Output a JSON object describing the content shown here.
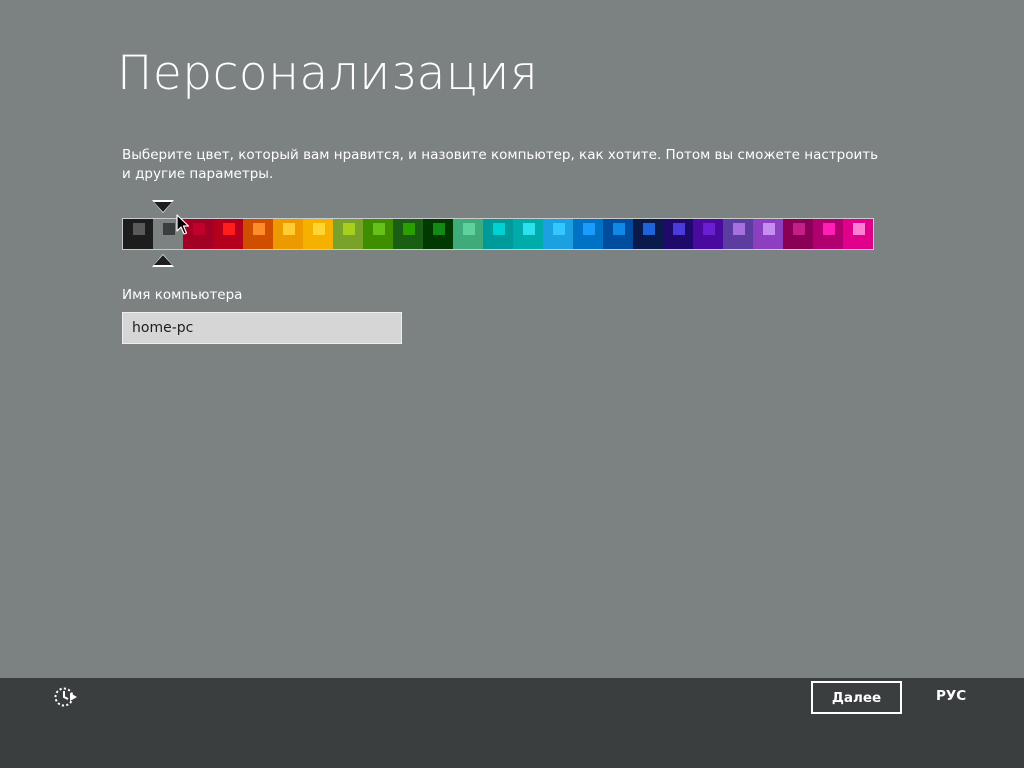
{
  "page": {
    "title": "Персонализация",
    "description": "Выберите цвет, который вам нравится, и назовите компьютер, как хотите. Потом вы сможете настроить и другие параметры."
  },
  "palette": {
    "selected_index": 1,
    "swatches": [
      {
        "background": "#1d1d1d",
        "accent": "#5a5a5a"
      },
      {
        "background": "#7c8282",
        "accent": "#3b3e3e"
      },
      {
        "background": "#a20025",
        "accent": "#c1002d"
      },
      {
        "background": "#b4001c",
        "accent": "#ff1d1d"
      },
      {
        "background": "#d04e00",
        "accent": "#ff8c2a"
      },
      {
        "background": "#ec9a00",
        "accent": "#ffcc33"
      },
      {
        "background": "#f6b100",
        "accent": "#ffd633"
      },
      {
        "background": "#78a22a",
        "accent": "#a6d01a"
      },
      {
        "background": "#3e8e00",
        "accent": "#66c21a"
      },
      {
        "background": "#195e13",
        "accent": "#2b9e00"
      },
      {
        "background": "#003a00",
        "accent": "#138a13"
      },
      {
        "background": "#3faa7a",
        "accent": "#5ed19d"
      },
      {
        "background": "#009a9a",
        "accent": "#00d2d2"
      },
      {
        "background": "#00abab",
        "accent": "#2be1ee"
      },
      {
        "background": "#1ba1e2",
        "accent": "#34c6ff"
      },
      {
        "background": "#0072c6",
        "accent": "#1a9cff"
      },
      {
        "background": "#004c9e",
        "accent": "#0d8ae8"
      },
      {
        "background": "#0a1a4a",
        "accent": "#1f63d8"
      },
      {
        "background": "#1d0a6b",
        "accent": "#4b3bd8"
      },
      {
        "background": "#4a0aa0",
        "accent": "#6a1fd0"
      },
      {
        "background": "#5a3d9e",
        "accent": "#a770e0"
      },
      {
        "background": "#8c3fbf",
        "accent": "#c78ef2"
      },
      {
        "background": "#8b0057",
        "accent": "#c21f88"
      },
      {
        "background": "#b0006f",
        "accent": "#ff1fb5"
      },
      {
        "background": "#e1008c",
        "accent": "#ff7fd6"
      }
    ]
  },
  "computer_name": {
    "label": "Имя компьютера",
    "value": "home-pc"
  },
  "footer": {
    "accessibility_icon": "ease-of-access-icon",
    "next_label": "Далее",
    "language": "РУС"
  },
  "colors": {
    "background": "#7c8282",
    "footer": "#3b3e3e",
    "text": "#ffffff"
  }
}
